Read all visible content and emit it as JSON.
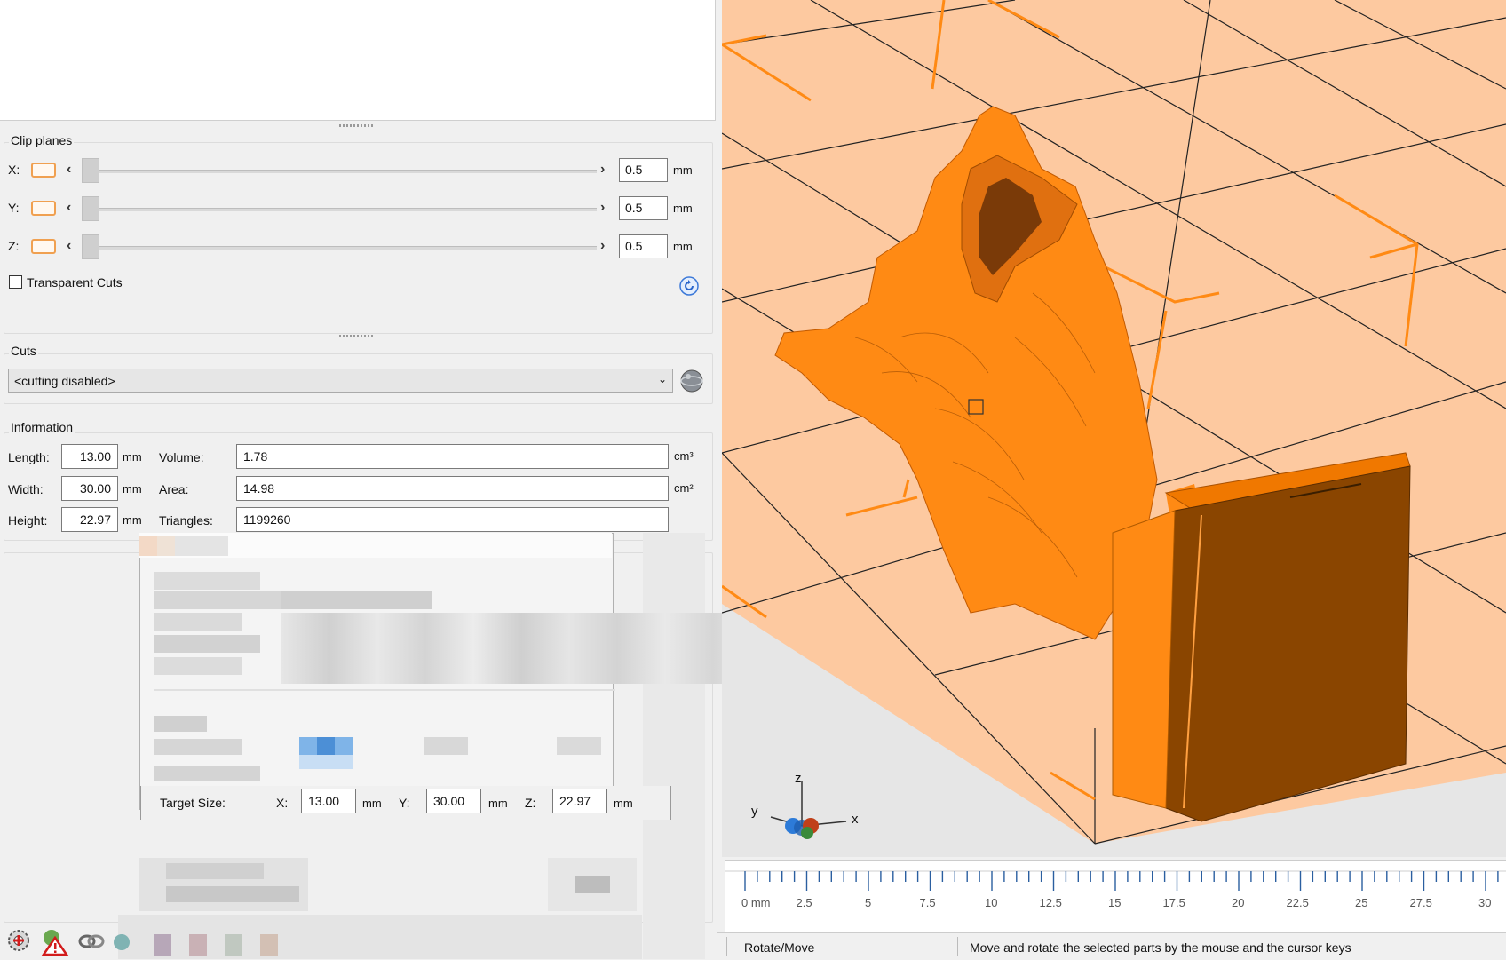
{
  "clip_planes": {
    "title": "Clip planes",
    "rows": [
      {
        "axis": "X:",
        "value": "0.5",
        "unit": "mm"
      },
      {
        "axis": "Y:",
        "value": "0.5",
        "unit": "mm"
      },
      {
        "axis": "Z:",
        "value": "0.5",
        "unit": "mm"
      }
    ],
    "transparent_cuts_label": "Transparent Cuts",
    "transparent_cuts_checked": false
  },
  "cuts": {
    "title": "Cuts",
    "selected": "<cutting disabled>"
  },
  "information": {
    "title": "Information",
    "length_label": "Length:",
    "length_value": "13.00",
    "width_label": "Width:",
    "width_value": "30.00",
    "height_label": "Height:",
    "height_value": "22.97",
    "mm": "mm",
    "volume_label": "Volume:",
    "volume_value": "1.78",
    "volume_unit": "cm³",
    "area_label": "Area:",
    "area_value": "14.98",
    "area_unit": "cm²",
    "triangles_label": "Triangles:",
    "triangles_value": "1199260"
  },
  "target_size": {
    "label": "Target Size:",
    "x_label": "X:",
    "x_value": "13.00",
    "y_label": "Y:",
    "y_value": "30.00",
    "z_label": "Z:",
    "z_value": "22.97",
    "unit": "mm"
  },
  "ruler": {
    "ticks": [
      "0 mm",
      "2.5",
      "5",
      "7.5",
      "10",
      "12.5",
      "15",
      "17.5",
      "20",
      "22.5",
      "25",
      "27.5",
      "30"
    ]
  },
  "axes_indicator": {
    "x": "x",
    "y": "y",
    "z": "z"
  },
  "status_bar": {
    "mode": "Rotate/Move",
    "hint": "Move and rotate the selected parts by the mouse and the cursor keys"
  },
  "colors": {
    "model": "#ff8a14",
    "bed": "#fdc9a0",
    "bed_lines": "#1a1a1a",
    "accent_orange": "#ff8a14"
  },
  "bottom_toolbar_icons": [
    "gear-add-icon",
    "warning-icon",
    "link-icon",
    "tool-icon"
  ]
}
